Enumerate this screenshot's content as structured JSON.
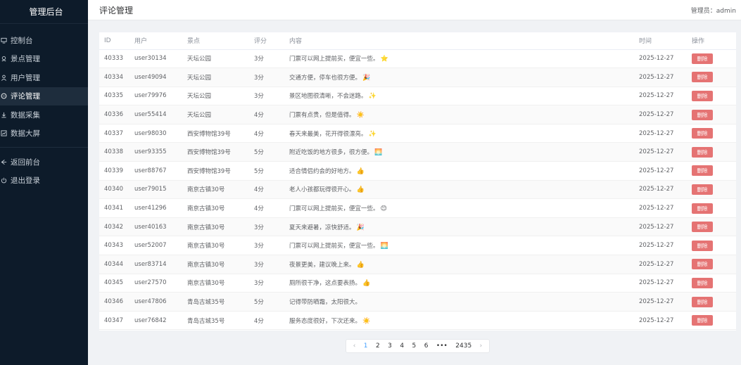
{
  "sidebar": {
    "brand": "管理后台",
    "items": [
      {
        "label": "控制台",
        "icon": "monitor-icon"
      },
      {
        "label": "景点管理",
        "icon": "location-icon"
      },
      {
        "label": "用户管理",
        "icon": "user-icon"
      },
      {
        "label": "评论管理",
        "icon": "comment-icon"
      },
      {
        "label": "数据采集",
        "icon": "download-icon"
      },
      {
        "label": "数据大屏",
        "icon": "chart-icon"
      }
    ],
    "bottom_items": [
      {
        "label": "返回前台",
        "icon": "back-icon"
      },
      {
        "label": "退出登录",
        "icon": "power-icon"
      }
    ],
    "active_index": 3
  },
  "header": {
    "title": "评论管理",
    "user": "管理员：admin"
  },
  "table": {
    "columns": [
      "ID",
      "用户",
      "景点",
      "评分",
      "内容",
      "时间",
      "操作"
    ],
    "delete_label": "删除",
    "rows": [
      {
        "id": "40333",
        "user": "user30134",
        "spot": "天坛公园",
        "score": "3分",
        "content": "门票可以网上提前买，便宜一些。",
        "emoji": "⭐",
        "time": "2025-12-27"
      },
      {
        "id": "40334",
        "user": "user49094",
        "spot": "天坛公园",
        "score": "3分",
        "content": "交通方便，停车也很方便。",
        "emoji": "🎉",
        "time": "2025-12-27"
      },
      {
        "id": "40335",
        "user": "user79976",
        "spot": "天坛公园",
        "score": "3分",
        "content": "景区地图很清晰，不会迷路。",
        "emoji": "✨",
        "time": "2025-12-27"
      },
      {
        "id": "40336",
        "user": "user55414",
        "spot": "天坛公园",
        "score": "4分",
        "content": "门票有点贵，但是值得。",
        "emoji": "☀️",
        "time": "2025-12-27"
      },
      {
        "id": "40337",
        "user": "user98030",
        "spot": "西安博物馆39号",
        "score": "4分",
        "content": "春天来最美，花开得很漂亮。",
        "emoji": "✨",
        "time": "2025-12-27"
      },
      {
        "id": "40338",
        "user": "user93355",
        "spot": "西安博物馆39号",
        "score": "5分",
        "content": "附近吃饭的地方很多，很方便。",
        "emoji": "🌅",
        "time": "2025-12-27"
      },
      {
        "id": "40339",
        "user": "user88767",
        "spot": "西安博物馆39号",
        "score": "5分",
        "content": "适合情侣约会的好地方。",
        "emoji": "👍",
        "time": "2025-12-27"
      },
      {
        "id": "40340",
        "user": "user79015",
        "spot": "南京古镇30号",
        "score": "4分",
        "content": "老人小孩都玩得很开心。",
        "emoji": "👍",
        "time": "2025-12-27"
      },
      {
        "id": "40341",
        "user": "user41296",
        "spot": "南京古镇30号",
        "score": "4分",
        "content": "门票可以网上提前买，便宜一些。",
        "emoji": "😊",
        "time": "2025-12-27"
      },
      {
        "id": "40342",
        "user": "user40163",
        "spot": "南京古镇30号",
        "score": "3分",
        "content": "夏天来避暑，凉快舒适。",
        "emoji": "🎉",
        "time": "2025-12-27"
      },
      {
        "id": "40343",
        "user": "user52007",
        "spot": "南京古镇30号",
        "score": "3分",
        "content": "门票可以网上提前买，便宜一些。",
        "emoji": "🌅",
        "time": "2025-12-27"
      },
      {
        "id": "40344",
        "user": "user83714",
        "spot": "南京古镇30号",
        "score": "3分",
        "content": "夜景更美，建议晚上来。",
        "emoji": "👍",
        "time": "2025-12-27"
      },
      {
        "id": "40345",
        "user": "user27570",
        "spot": "南京古镇30号",
        "score": "3分",
        "content": "厕所很干净，这点要表扬。",
        "emoji": "👍",
        "time": "2025-12-27"
      },
      {
        "id": "40346",
        "user": "user47806",
        "spot": "青岛古城35号",
        "score": "5分",
        "content": "记得带防晒霜，太阳很大。",
        "emoji": "",
        "time": "2025-12-27"
      },
      {
        "id": "40347",
        "user": "user76842",
        "spot": "青岛古城35号",
        "score": "4分",
        "content": "服务态度很好，下次还来。",
        "emoji": "☀️",
        "time": "2025-12-27"
      }
    ]
  },
  "pagination": {
    "prev": "‹",
    "next": "›",
    "pages": [
      "1",
      "2",
      "3",
      "4",
      "5",
      "6"
    ],
    "ellipsis": "•••",
    "last": "2435",
    "current": "1"
  }
}
